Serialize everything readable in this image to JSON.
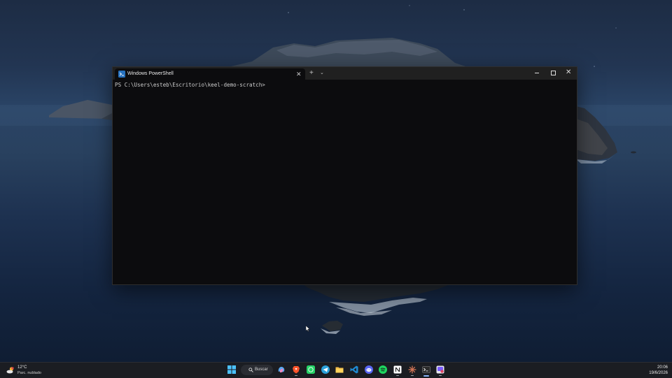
{
  "terminal": {
    "tab_title": "Windows PowerShell",
    "prompt": "PS C:\\Users\\esteb\\Escritorio\\keel-demo-scratch>",
    "tab_close_glyph": "✕",
    "new_tab_glyph": "+",
    "dropdown_glyph": "⌄",
    "close_glyph": "✕"
  },
  "taskbar": {
    "weather": {
      "temperature": "12°C",
      "condition": "Parc. nublado"
    },
    "search_label": "Buscar",
    "apps": [
      {
        "name": "copilot",
        "icon": "copilot-icon"
      },
      {
        "name": "brave",
        "icon": "brave-icon"
      },
      {
        "name": "whatsapp",
        "icon": "whatsapp-icon"
      },
      {
        "name": "telegram",
        "icon": "telegram-icon"
      },
      {
        "name": "file-explorer",
        "icon": "folder-icon"
      },
      {
        "name": "vscode",
        "icon": "vscode-icon"
      },
      {
        "name": "discord",
        "icon": "discord-icon"
      },
      {
        "name": "spotify",
        "icon": "spotify-icon"
      },
      {
        "name": "notion",
        "icon": "notion-icon"
      },
      {
        "name": "claude",
        "icon": "claude-icon"
      },
      {
        "name": "terminal",
        "icon": "terminal-icon"
      },
      {
        "name": "snipping-tool",
        "icon": "snipping-tool-icon"
      }
    ],
    "clock": {
      "time": "20:06",
      "date": "19/6/2026"
    }
  },
  "colors": {
    "taskbar_bg": "#1b1d22",
    "terminal_bg": "#0c0c0e",
    "titlebar_bg": "#202020",
    "accent": "#8ab4f8"
  }
}
